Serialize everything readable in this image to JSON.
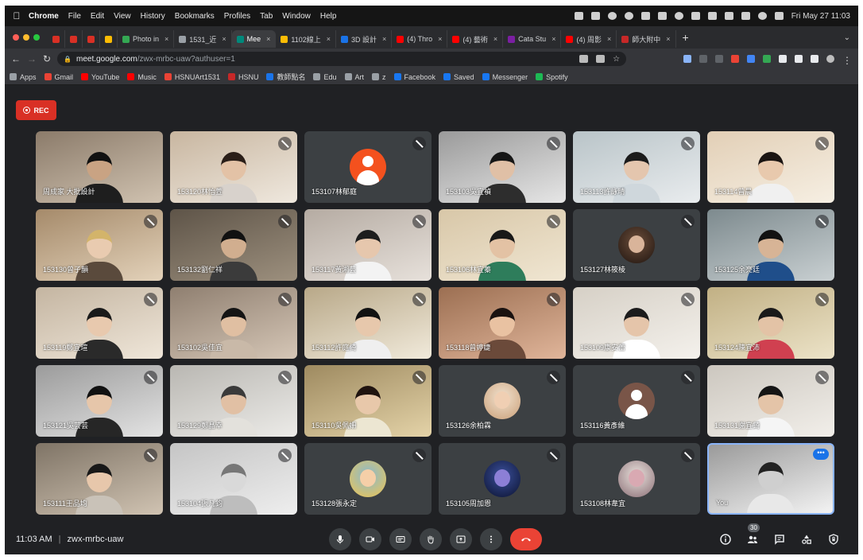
{
  "menubar": {
    "app_name": "Chrome",
    "items": [
      "File",
      "Edit",
      "View",
      "History",
      "Bookmarks",
      "Profiles",
      "Tab",
      "Window",
      "Help"
    ],
    "clock": "Fri May 27  11:03"
  },
  "tabs": [
    {
      "label": "",
      "color": "#d93025"
    },
    {
      "label": "",
      "color": "#d93025"
    },
    {
      "label": "",
      "color": "#d93025"
    },
    {
      "label": "",
      "color": "#fbbc04"
    },
    {
      "label": "Photo in",
      "color": "#34a853"
    },
    {
      "label": "1531_近",
      "color": "#9aa0a6"
    },
    {
      "label": "Mee",
      "color": "#00897b",
      "active": true
    },
    {
      "label": "1102線上",
      "color": "#fbbc04"
    },
    {
      "label": "3D 設計",
      "color": "#1a73e8"
    },
    {
      "label": "(4) Thro",
      "color": "#ff0000"
    },
    {
      "label": "(4) 藝術",
      "color": "#ff0000"
    },
    {
      "label": "Cata Stu",
      "color": "#7b1fa2"
    },
    {
      "label": "(4) 周影",
      "color": "#ff0000"
    },
    {
      "label": "師大附中",
      "color": "#c62828"
    }
  ],
  "address": {
    "host": "meet.google.com",
    "path": "/zwx-mrbc-uaw?authuser=1"
  },
  "bookmarks": [
    {
      "label": "Apps",
      "color": "#9aa0a6"
    },
    {
      "label": "Gmail",
      "color": "#ea4335"
    },
    {
      "label": "YouTube",
      "color": "#ff0000"
    },
    {
      "label": "Music",
      "color": "#ff0000"
    },
    {
      "label": "HSNUArt1531",
      "color": "#ea4335"
    },
    {
      "label": "HSNU",
      "color": "#c62828"
    },
    {
      "label": "教師點名",
      "color": "#1a73e8"
    },
    {
      "label": "Edu",
      "color": "#9aa0a6"
    },
    {
      "label": "Art",
      "color": "#9aa0a6"
    },
    {
      "label": "z",
      "color": "#9aa0a6"
    },
    {
      "label": "Facebook",
      "color": "#1877f2"
    },
    {
      "label": "Saved",
      "color": "#1877f2"
    },
    {
      "label": "Messenger",
      "color": "#1877f2"
    },
    {
      "label": "Spotify",
      "color": "#1db954"
    }
  ],
  "recording": {
    "label": "REC"
  },
  "participants": [
    {
      "name": "周成家 大批設計",
      "type": "cam",
      "muted": false,
      "c1": "#8b7b6a",
      "c2": "#d0c2b0",
      "skin": "#c9a383",
      "hair": "#111",
      "shirt": "#1e1e1e"
    },
    {
      "name": "153120林怡萱",
      "type": "cam",
      "muted": true,
      "c1": "#c8b6a0",
      "c2": "#efe8de",
      "skin": "#e3c2a6",
      "hair": "#2a1e18",
      "shirt": "#d8d2cc"
    },
    {
      "name": "153107林郁庭",
      "type": "avatar",
      "muted": true,
      "avatar": "generic"
    },
    {
      "name": "153103吳宜禎",
      "type": "cam",
      "muted": true,
      "c1": "#9a9a9a",
      "c2": "#e6e6e6",
      "skin": "#e0c0a6",
      "hair": "#161616",
      "shirt": "#2d2d2d"
    },
    {
      "name": "153113許詠晴",
      "type": "cam",
      "muted": true,
      "c1": "#b9c4c8",
      "c2": "#e9ecee",
      "skin": "#e4c6ae",
      "hair": "#1b1b1b",
      "shirt": "#cfd7dc"
    },
    {
      "name": "153114曾晨",
      "type": "cam",
      "muted": true,
      "c1": "#e2cfb6",
      "c2": "#f6efe3",
      "skin": "#e8c9ad",
      "hair": "#1a1412",
      "shirt": "#f0f0f0"
    },
    {
      "name": "153130曾子韻",
      "type": "cam",
      "muted": true,
      "c1": "#a58a6a",
      "c2": "#e3d2ba",
      "skin": "#e9cbb0",
      "hair": "#d3b46a",
      "shirt": "#5a4a3c"
    },
    {
      "name": "153132劉仁祥",
      "type": "cam",
      "muted": true,
      "c1": "#5e5448",
      "c2": "#9d907e",
      "skin": "#d1ae8f",
      "hair": "#111",
      "shirt": "#3b3b3b"
    },
    {
      "name": "153117黃湘芸",
      "type": "cam",
      "muted": true,
      "c1": "#b5aba2",
      "c2": "#e7e1db",
      "skin": "#e6c7ad",
      "hair": "#1d1d1d",
      "shirt": "#f3f3f3"
    },
    {
      "name": "153106林宜蓁",
      "type": "cam",
      "muted": true,
      "c1": "#d8c7a8",
      "c2": "#f0e6d2",
      "skin": "#e3c2a4",
      "hair": "#181818",
      "shirt": "#2e7d5b"
    },
    {
      "name": "153127林筱棱",
      "type": "avatar",
      "muted": true,
      "avatar": "photo",
      "a1": "#6b4d3a",
      "a2": "#201510",
      "a3": "#d9b49a"
    },
    {
      "name": "153125余亮廷",
      "type": "cam",
      "muted": true,
      "c1": "#7d8a8e",
      "c2": "#c9d0d2",
      "skin": "#d7b496",
      "hair": "#121212",
      "shirt": "#1f4e8a"
    },
    {
      "name": "153119鄭宜瑄",
      "type": "cam",
      "muted": true,
      "c1": "#c4b5a1",
      "c2": "#efe6d9",
      "skin": "#e8c9ae",
      "hair": "#1a1a1a",
      "shirt": "#2a2a2a"
    },
    {
      "name": "153102吳佳宜",
      "type": "cam",
      "muted": true,
      "c1": "#8f7f70",
      "c2": "#d5c6b6",
      "skin": "#e0bfa2",
      "hair": "#141414",
      "shirt": "#c9b9a8"
    },
    {
      "name": "153112許庭綺",
      "type": "cam",
      "muted": true,
      "c1": "#b8a888",
      "c2": "#f1eadb",
      "skin": "#e7c8ac",
      "hair": "#121212",
      "shirt": "#efefef"
    },
    {
      "name": "153118曾婷婕",
      "type": "cam",
      "muted": true,
      "c1": "#9c6f52",
      "c2": "#e0b59a",
      "skin": "#e9c2a2",
      "hair": "#1a1210",
      "shirt": "#6b4a3a"
    },
    {
      "name": "153109康安蕾",
      "type": "cam",
      "muted": true,
      "c1": "#d6d0c6",
      "c2": "#f4f1ec",
      "skin": "#e5c5aa",
      "hair": "#1c1c1c",
      "shirt": "#ffffff"
    },
    {
      "name": "153124陳宜沛",
      "type": "cam",
      "muted": true,
      "c1": "#c1b084",
      "c2": "#ece3c8",
      "skin": "#e3c3a6",
      "hair": "#1a1a1a",
      "shirt": "#d04050"
    },
    {
      "name": "153121吳芸芸",
      "type": "cam",
      "muted": true,
      "c1": "#9b9b9b",
      "c2": "#e3e3e3",
      "skin": "#e6c6aa",
      "hair": "#111",
      "shirt": "#262626"
    },
    {
      "name": "153129鄭晶幸",
      "type": "cam",
      "muted": true,
      "c1": "#b9b7b2",
      "c2": "#ecebe8",
      "skin": "#e1c0a4",
      "hair": "#3a3a3a",
      "shirt": "#e3e1dc"
    },
    {
      "name": "153110吳佩姍",
      "type": "cam",
      "muted": true,
      "c1": "#9e8a60",
      "c2": "#e4d3a8",
      "skin": "#e8c8aa",
      "hair": "#201410",
      "shirt": "#ece6d2"
    },
    {
      "name": "153126余柏霖",
      "type": "avatar",
      "muted": true,
      "avatar": "photo",
      "a1": "#f1e2cf",
      "a2": "#c99f78",
      "a3": "#f0cfb3"
    },
    {
      "name": "153116黃彥維",
      "type": "avatar",
      "muted": true,
      "avatar": "generic-brown"
    },
    {
      "name": "153131謝宜錡",
      "type": "cam",
      "muted": true,
      "c1": "#ccc7bf",
      "c2": "#f2efea",
      "skin": "#e4c4a8",
      "hair": "#151515",
      "shirt": "#f5f5f5"
    },
    {
      "name": "153111王品均",
      "type": "cam",
      "muted": true,
      "c1": "#7f7466",
      "c2": "#d0c3b2",
      "skin": "#e7c7ab",
      "hair": "#181818",
      "shirt": "#c9c2b8"
    },
    {
      "name": "153104張凡鈞",
      "type": "cam",
      "muted": true,
      "c1": "#c5c5c5",
      "c2": "#eeeeee",
      "skin": "#d9d9d9",
      "hair": "#777",
      "shirt": "#bdbdbd"
    },
    {
      "name": "153128張永定",
      "type": "avatar",
      "muted": true,
      "avatar": "photo",
      "a1": "#86b9d1",
      "a2": "#f3c54d",
      "a3": "#f5cfa8"
    },
    {
      "name": "153105周加恩",
      "type": "avatar",
      "muted": true,
      "avatar": "photo",
      "a1": "#3a4f9a",
      "a2": "#0b1230",
      "a3": "#8c7fd6"
    },
    {
      "name": "153108林韋宜",
      "type": "avatar",
      "muted": true,
      "avatar": "photo",
      "a1": "#e9e2dc",
      "a2": "#8a6e76",
      "a3": "#d9a9b2"
    },
    {
      "name": "You",
      "type": "cam",
      "muted": false,
      "self": true,
      "c1": "#9a9a9a",
      "c2": "#f3f3f3",
      "skin": "#cfcfcf",
      "hair": "#222",
      "shirt": "#e8e8e8"
    }
  ],
  "meeting": {
    "time": "11:03 AM",
    "separator": "|",
    "code": "zwx-mrbc-uaw",
    "people_count": "30"
  }
}
